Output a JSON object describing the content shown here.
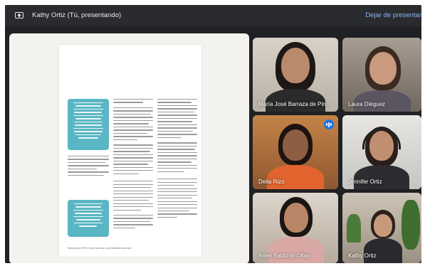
{
  "header": {
    "title": "Kathy Ortiz (Tú, presentando)",
    "stop_presenting": "Dejar de presentar",
    "present_icon": "present-to-all-icon"
  },
  "document": {
    "footer": "Metodología KSFH   |   Observatorio de sustentabilidad ambiental",
    "callouts": 2
  },
  "participants": [
    {
      "name": "María José Barraza de Pin..."
    },
    {
      "name": "Laura Diéguez"
    },
    {
      "name": "Delia Rizo",
      "speaking": true
    },
    {
      "name": "Jennifer Ortiz"
    },
    {
      "name": "Arlen Baldizón Ollas"
    },
    {
      "name": "Kathy Ortiz"
    }
  ],
  "colors": {
    "background": "#202124",
    "accent": "#8ab4f8",
    "speaking_badge": "#1a73e8",
    "callout": "#59b6c5"
  }
}
